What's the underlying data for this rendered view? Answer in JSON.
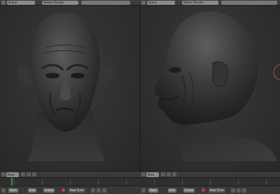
{
  "header": {
    "left": {
      "mode_label": "Scene",
      "object_field": "Master Render"
    },
    "right": {
      "mode_label": "Scene",
      "object_field": "Master Render"
    }
  },
  "bottom": {
    "left_mode": "Pose",
    "right_mode": "Pose",
    "playback_tags": [
      "Start",
      "End",
      "Frame",
      "Start",
      "End",
      "Frame"
    ],
    "real_time_label": "Real Time"
  },
  "viewports": {
    "left": {
      "content": "front-view-sculpt-head"
    },
    "right": {
      "content": "side-view-sculpt-head"
    }
  }
}
